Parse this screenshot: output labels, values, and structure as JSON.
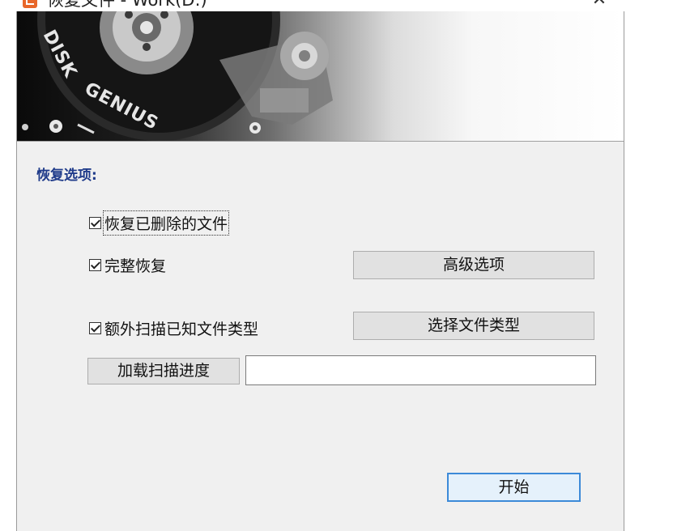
{
  "window": {
    "title": "恢复文件 - Work(D:)",
    "close_glyph": "✕"
  },
  "banner": {
    "logo_text": "DISK GENIUS"
  },
  "options": {
    "group_title": "恢复选项:",
    "recover_deleted": {
      "label": "恢复已删除的文件",
      "checked": true
    },
    "full_recover": {
      "label": "完整恢复",
      "checked": true
    },
    "extra_scan": {
      "label": "额外扫描已知文件类型",
      "checked": true
    }
  },
  "buttons": {
    "advanced": "高级选项",
    "select_types": "选择文件类型",
    "load_progress": "加载扫描进度",
    "start": "开始"
  },
  "progress_path": {
    "value": ""
  },
  "colors": {
    "dialog_bg": "#f0f0f0",
    "group_title": "#1f3b8a",
    "default_button_border": "#3c8ad8",
    "app_icon": "#e8672a"
  },
  "icons": {
    "app": "disk-genius-app-icon",
    "close": "close-icon",
    "check": "check-icon"
  }
}
